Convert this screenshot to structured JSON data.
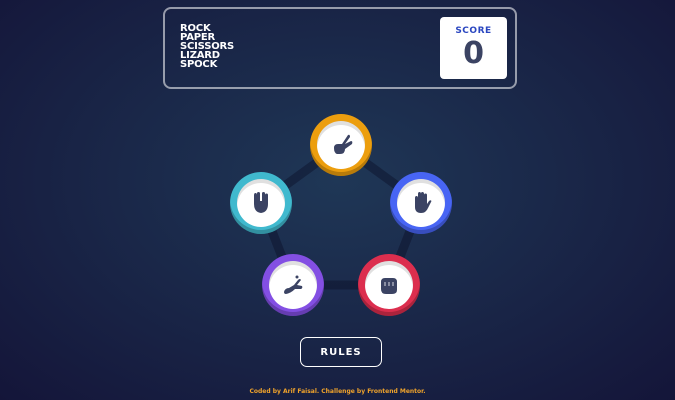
{
  "header": {
    "titles": [
      "ROCK",
      "PAPER",
      "SCISSORS",
      "LIZARD",
      "SPOCK"
    ],
    "score_label": "SCORE",
    "score_value": "0"
  },
  "choices": [
    {
      "name": "scissors",
      "icon": "scissors-hand-icon",
      "color": "#ec9e0e"
    },
    {
      "name": "paper",
      "icon": "paper-hand-icon",
      "color": "#4865f4"
    },
    {
      "name": "rock",
      "icon": "rock-fist-icon",
      "color": "#dc2e4e"
    },
    {
      "name": "lizard",
      "icon": "lizard-hand-icon",
      "color": "#834fe3"
    },
    {
      "name": "spock",
      "icon": "spock-hand-icon",
      "color": "#40b9ce"
    }
  ],
  "rules_button": "RULES",
  "footer": "Coded by Arif Faisal. Challenge by Frontend Mentor."
}
